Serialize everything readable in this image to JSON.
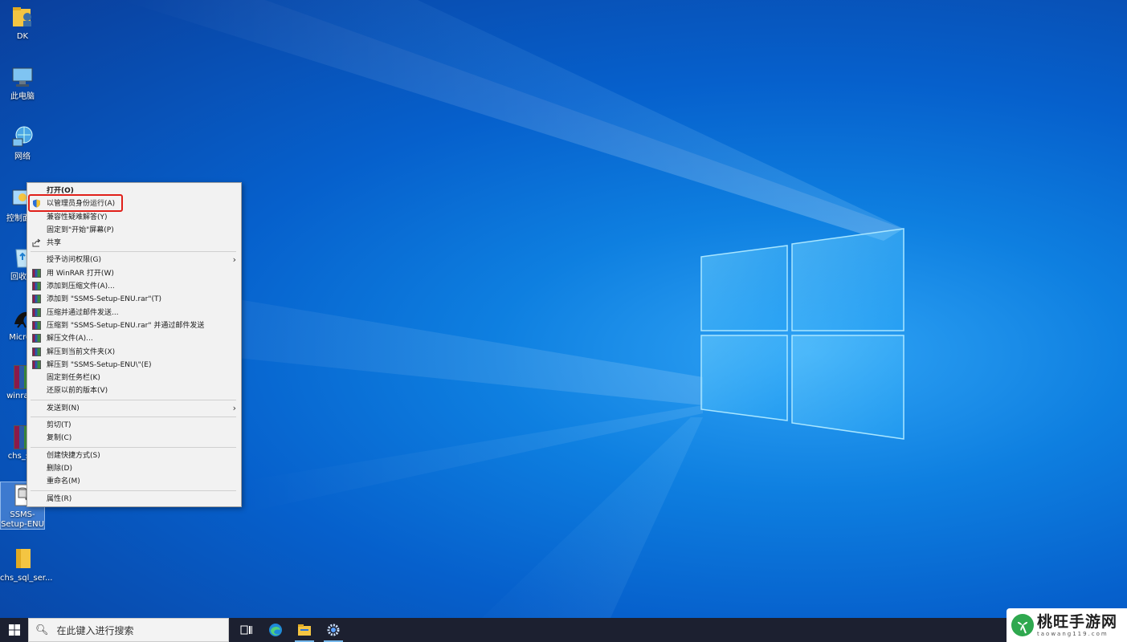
{
  "desktop": {
    "icons": [
      {
        "label": "DK"
      },
      {
        "label": "此电脑"
      },
      {
        "label": "网络"
      },
      {
        "label": "控制面板"
      },
      {
        "label": "回收站"
      },
      {
        "label": "MicroK"
      },
      {
        "label": "winrar-s"
      },
      {
        "label": "chs_sql"
      },
      {
        "label": "SSMS-Setup-ENU"
      },
      {
        "label": "chs_sql_ser..."
      }
    ]
  },
  "context_menu": {
    "items": [
      {
        "label": "打开(O)"
      },
      {
        "label": "以管理员身份运行(A)"
      },
      {
        "label": "兼容性疑难解答(Y)"
      },
      {
        "label": "固定到\"开始\"屏幕(P)"
      },
      {
        "label": "共享"
      },
      {
        "label": "授予访问权限(G)"
      },
      {
        "label": "用 WinRAR 打开(W)"
      },
      {
        "label": "添加到压缩文件(A)..."
      },
      {
        "label": "添加到 \"SSMS-Setup-ENU.rar\"(T)"
      },
      {
        "label": "压缩并通过邮件发送..."
      },
      {
        "label": "压缩到 \"SSMS-Setup-ENU.rar\" 并通过邮件发送"
      },
      {
        "label": "解压文件(A)..."
      },
      {
        "label": "解压到当前文件夹(X)"
      },
      {
        "label": "解压到 \"SSMS-Setup-ENU\\\"(E)"
      },
      {
        "label": "固定到任务栏(K)"
      },
      {
        "label": "还原以前的版本(V)"
      },
      {
        "label": "发送到(N)"
      },
      {
        "label": "剪切(T)"
      },
      {
        "label": "复制(C)"
      },
      {
        "label": "创建快捷方式(S)"
      },
      {
        "label": "删除(D)"
      },
      {
        "label": "重命名(M)"
      },
      {
        "label": "属性(R)"
      }
    ],
    "highlight_color": "#e0201a"
  },
  "taskbar": {
    "search_placeholder": "在此键入进行搜索",
    "apps": [
      {
        "name": "task-view-icon"
      },
      {
        "name": "edge-icon"
      },
      {
        "name": "file-explorer-icon"
      },
      {
        "name": "settings-icon"
      }
    ]
  },
  "watermark": {
    "title": "桃旺手游网",
    "subtitle": "taowang119.com"
  }
}
